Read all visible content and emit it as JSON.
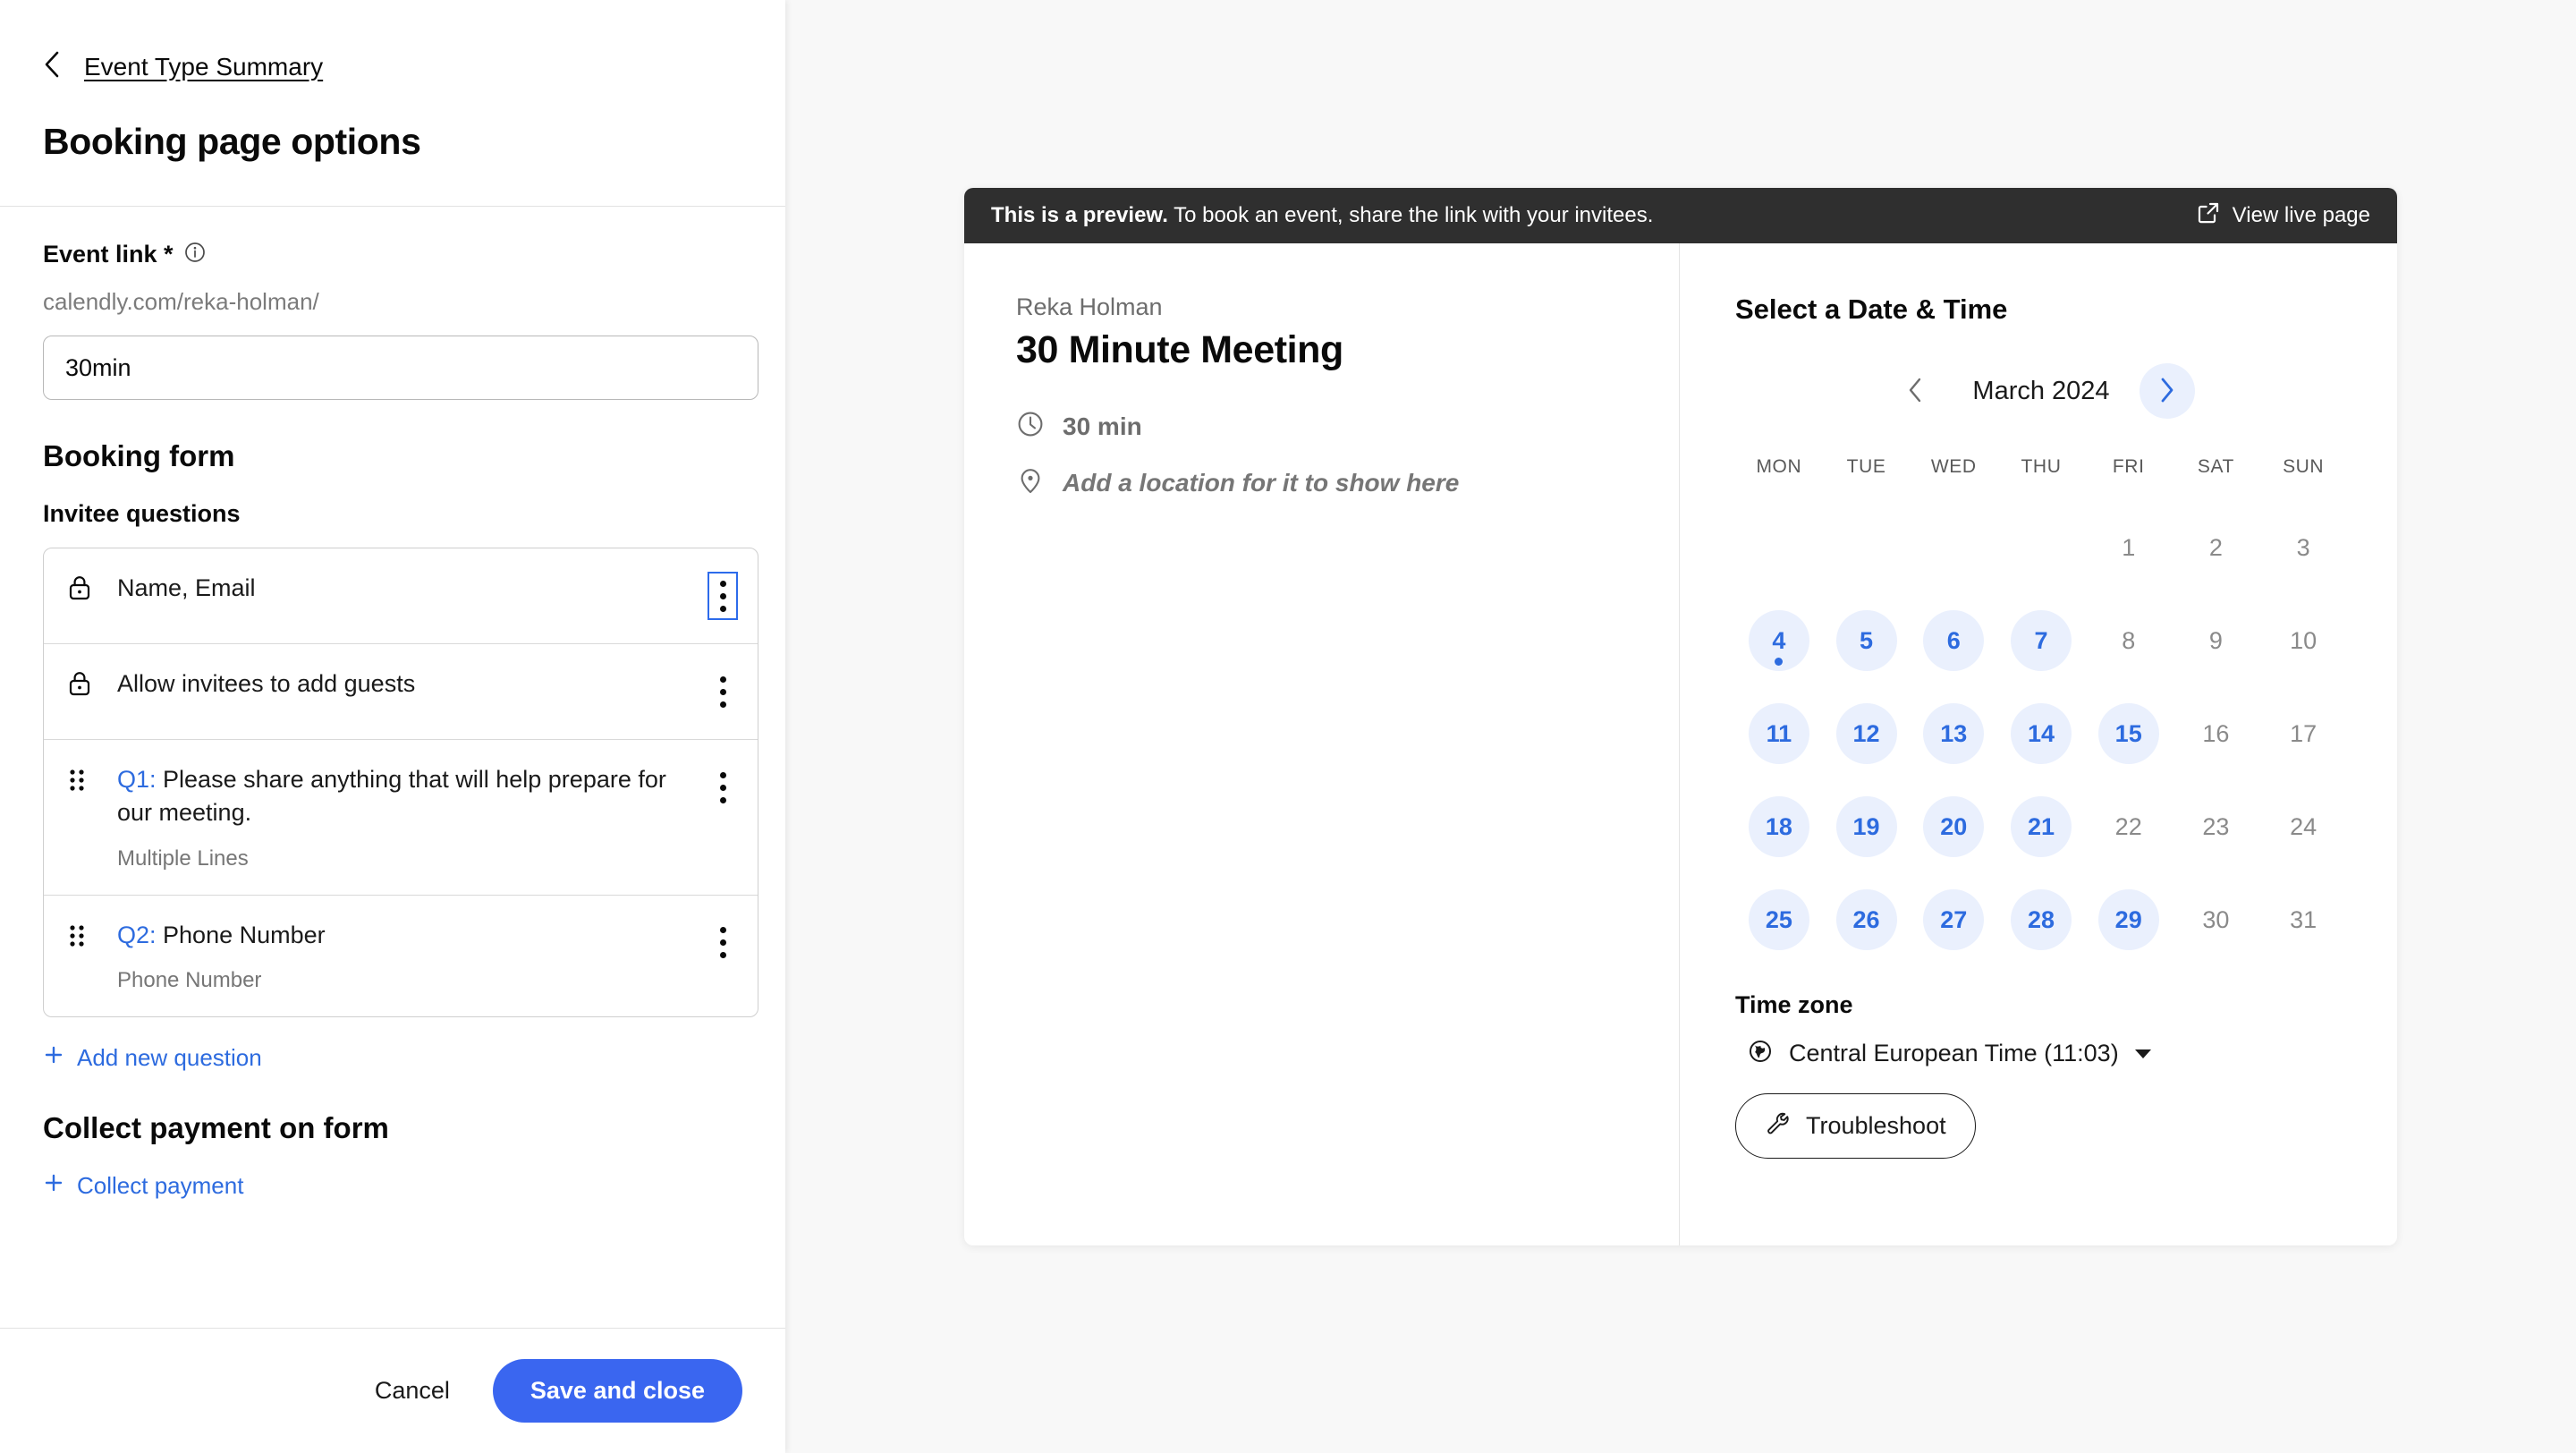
{
  "left_panel": {
    "back_link": "Event Type Summary",
    "page_title": "Booking page options",
    "event_link": {
      "label": "Event link *",
      "url_prefix": "calendly.com/reka-holman/",
      "slug_value": "30min",
      "slug_placeholder": "30min"
    },
    "booking_form_title": "Booking form",
    "invitee_questions_title": "Invitee questions",
    "questions": [
      {
        "lead": "lock",
        "text": "Name, Email",
        "num": "",
        "sub": "",
        "focused": true
      },
      {
        "lead": "lock",
        "text": "Allow invitees to add guests",
        "num": "",
        "sub": "",
        "focused": false
      },
      {
        "lead": "drag",
        "num": "Q1:",
        "text": " Please share anything that will help prepare for our meeting.",
        "sub": "Multiple Lines",
        "focused": false
      },
      {
        "lead": "drag",
        "num": "Q2:",
        "text": " Phone Number",
        "sub": "Phone Number",
        "focused": false
      }
    ],
    "add_question_label": "Add new question",
    "collect_payment_title": "Collect payment on form",
    "collect_payment_label": "Collect payment",
    "cancel_label": "Cancel",
    "save_label": "Save and close"
  },
  "preview": {
    "banner_strong": "This is a preview.",
    "banner_rest": " To book an event, share the link with your invitees.",
    "view_live_label": "View live page",
    "host_name": "Reka Holman",
    "event_title": "30 Minute Meeting",
    "duration": "30 min",
    "location_placeholder": "Add a location for it to show here",
    "select_title": "Select a Date & Time",
    "month_label": "March 2024",
    "day_headers": [
      "MON",
      "TUE",
      "WED",
      "THU",
      "FRI",
      "SAT",
      "SUN"
    ],
    "calendar_days": [
      {
        "n": "",
        "state": "empty"
      },
      {
        "n": "",
        "state": "empty"
      },
      {
        "n": "",
        "state": "empty"
      },
      {
        "n": "",
        "state": "empty"
      },
      {
        "n": "1",
        "state": "muted"
      },
      {
        "n": "2",
        "state": "muted"
      },
      {
        "n": "3",
        "state": "muted"
      },
      {
        "n": "4",
        "state": "avail",
        "today": true
      },
      {
        "n": "5",
        "state": "avail"
      },
      {
        "n": "6",
        "state": "avail"
      },
      {
        "n": "7",
        "state": "avail"
      },
      {
        "n": "8",
        "state": "muted"
      },
      {
        "n": "9",
        "state": "muted"
      },
      {
        "n": "10",
        "state": "muted"
      },
      {
        "n": "11",
        "state": "avail"
      },
      {
        "n": "12",
        "state": "avail"
      },
      {
        "n": "13",
        "state": "avail"
      },
      {
        "n": "14",
        "state": "avail"
      },
      {
        "n": "15",
        "state": "avail"
      },
      {
        "n": "16",
        "state": "muted"
      },
      {
        "n": "17",
        "state": "muted"
      },
      {
        "n": "18",
        "state": "avail"
      },
      {
        "n": "19",
        "state": "avail"
      },
      {
        "n": "20",
        "state": "avail"
      },
      {
        "n": "21",
        "state": "avail"
      },
      {
        "n": "22",
        "state": "muted"
      },
      {
        "n": "23",
        "state": "muted"
      },
      {
        "n": "24",
        "state": "muted"
      },
      {
        "n": "25",
        "state": "avail"
      },
      {
        "n": "26",
        "state": "avail"
      },
      {
        "n": "27",
        "state": "avail"
      },
      {
        "n": "28",
        "state": "avail"
      },
      {
        "n": "29",
        "state": "avail"
      },
      {
        "n": "30",
        "state": "muted"
      },
      {
        "n": "31",
        "state": "muted"
      }
    ],
    "timezone_title": "Time zone",
    "timezone_value": "Central European Time (11:03)",
    "troubleshoot_label": "Troubleshoot"
  },
  "colors": {
    "accent_blue": "#2d6bdf",
    "primary_button": "#3a66f0",
    "focus_ring": "#2d6beb",
    "day_available_bg": "#eaf0fd",
    "banner_bg": "#2f2f2f",
    "page_bg": "#f8f8f8"
  }
}
